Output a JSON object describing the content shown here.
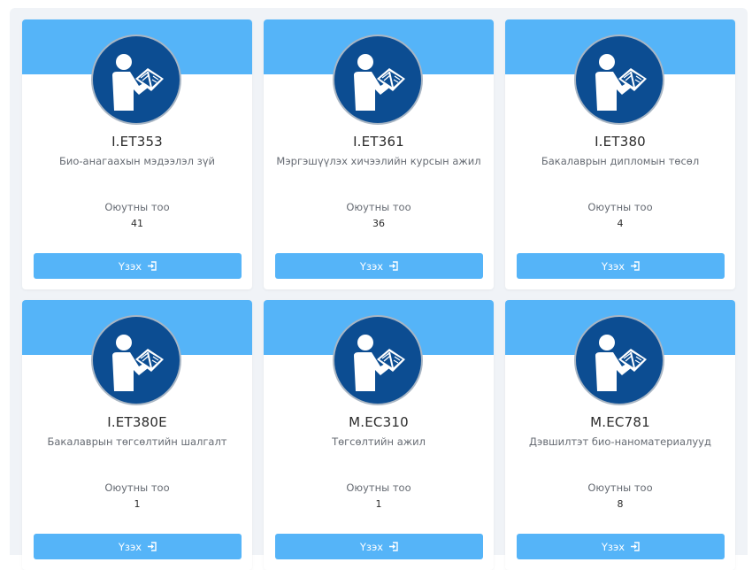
{
  "student_count_label": "Оюутны тоо",
  "view_button_label": "Үзэх",
  "colors": {
    "accent": "#55b4f8",
    "avatar_bg": "#0c4d92"
  },
  "courses": [
    {
      "code": "I.ET353",
      "name": "Био-анагаахын мэдээлэл зүй",
      "count": "41"
    },
    {
      "code": "I.ET361",
      "name": "Мэргэшүүлэх хичээлийн курсын ажил",
      "count": "36"
    },
    {
      "code": "I.ET380",
      "name": "Бакалаврын дипломын төсөл",
      "count": "4"
    },
    {
      "code": "I.ET380E",
      "name": "Бакалаврын төгсөлтийн шалгалт",
      "count": "1"
    },
    {
      "code": "M.EC310",
      "name": "Төгсөлтийн ажил",
      "count": "1"
    },
    {
      "code": "M.EC781",
      "name": "Дэвшилтэт био-наноматериалууд",
      "count": "8"
    }
  ]
}
